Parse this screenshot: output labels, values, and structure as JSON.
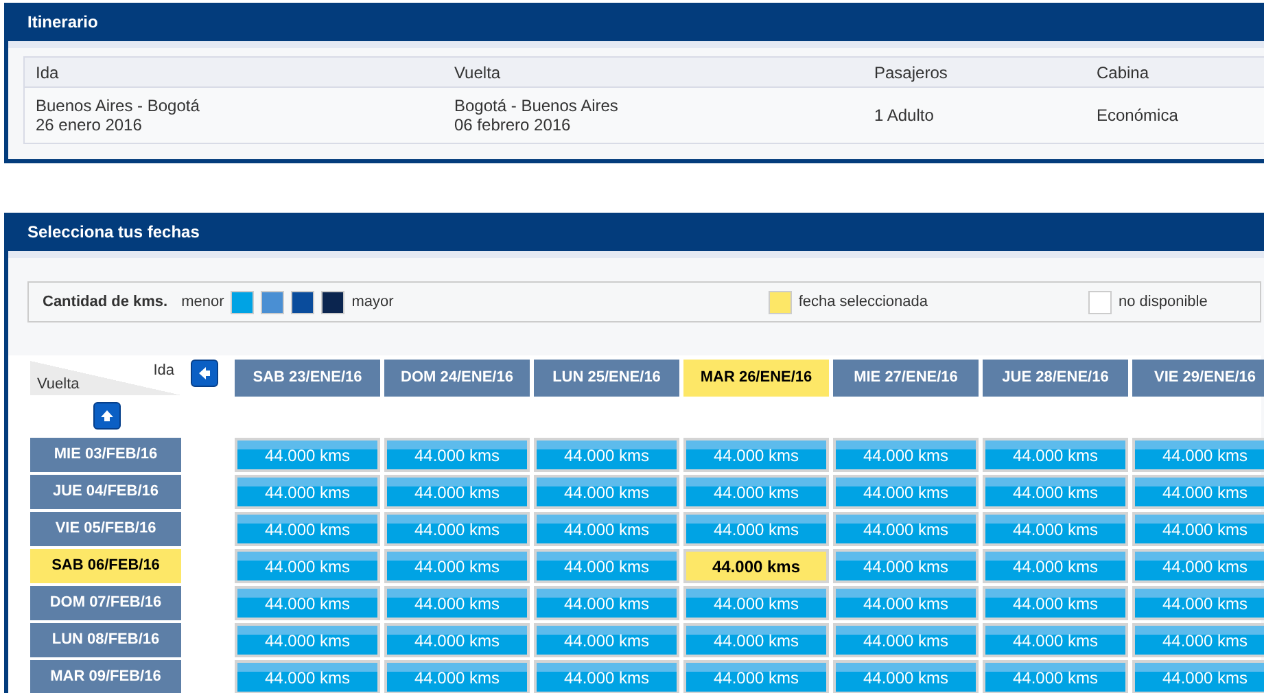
{
  "itinerary": {
    "title": "Itinerario",
    "columns": [
      "Ida",
      "Vuelta",
      "Pasajeros",
      "Cabina"
    ],
    "row": [
      {
        "lines": [
          "Buenos Aires - Bogotá",
          "26 enero 2016"
        ]
      },
      {
        "lines": [
          "Bogotá - Buenos Aires",
          "06 febrero 2016"
        ]
      },
      {
        "lines": [
          "1 Adulto"
        ]
      },
      {
        "lines": [
          "Económica"
        ]
      }
    ]
  },
  "dates": {
    "title": "Selecciona tus fechas",
    "legend": {
      "label": "Cantidad de kms.",
      "low": "menor",
      "high": "mayor",
      "swatches": [
        {
          "color": "#00a3e4"
        },
        {
          "color": "#4a8fd3"
        },
        {
          "color": "#0a4c9c"
        },
        {
          "color": "#0b254f"
        }
      ],
      "selected_label": "fecha seleccionada",
      "unavailable_label": "no disponible"
    },
    "corner": {
      "ida": "Ida",
      "vuelta": "Vuelta"
    },
    "columns": [
      {
        "label": "SAB 23/ENE/16",
        "selected": false
      },
      {
        "label": "DOM 24/ENE/16",
        "selected": false
      },
      {
        "label": "LUN 25/ENE/16",
        "selected": false
      },
      {
        "label": "MAR 26/ENE/16",
        "selected": true
      },
      {
        "label": "MIE 27/ENE/16",
        "selected": false
      },
      {
        "label": "JUE 28/ENE/16",
        "selected": false
      },
      {
        "label": "VIE 29/ENE/16",
        "selected": false
      }
    ],
    "rows": [
      {
        "label": "MIE 03/FEB/16",
        "selected": false,
        "cells": [
          {
            "text": "44.000 kms",
            "selected": false
          },
          {
            "text": "44.000 kms",
            "selected": false
          },
          {
            "text": "44.000 kms",
            "selected": false
          },
          {
            "text": "44.000 kms",
            "selected": false
          },
          {
            "text": "44.000 kms",
            "selected": false
          },
          {
            "text": "44.000 kms",
            "selected": false
          },
          {
            "text": "44.000 kms",
            "selected": false
          }
        ]
      },
      {
        "label": "JUE 04/FEB/16",
        "selected": false,
        "cells": [
          {
            "text": "44.000 kms",
            "selected": false
          },
          {
            "text": "44.000 kms",
            "selected": false
          },
          {
            "text": "44.000 kms",
            "selected": false
          },
          {
            "text": "44.000 kms",
            "selected": false
          },
          {
            "text": "44.000 kms",
            "selected": false
          },
          {
            "text": "44.000 kms",
            "selected": false
          },
          {
            "text": "44.000 kms",
            "selected": false
          }
        ]
      },
      {
        "label": "VIE 05/FEB/16",
        "selected": false,
        "cells": [
          {
            "text": "44.000 kms",
            "selected": false
          },
          {
            "text": "44.000 kms",
            "selected": false
          },
          {
            "text": "44.000 kms",
            "selected": false
          },
          {
            "text": "44.000 kms",
            "selected": false
          },
          {
            "text": "44.000 kms",
            "selected": false
          },
          {
            "text": "44.000 kms",
            "selected": false
          },
          {
            "text": "44.000 kms",
            "selected": false
          }
        ]
      },
      {
        "label": "SAB 06/FEB/16",
        "selected": true,
        "cells": [
          {
            "text": "44.000 kms",
            "selected": false
          },
          {
            "text": "44.000 kms",
            "selected": false
          },
          {
            "text": "44.000 kms",
            "selected": false
          },
          {
            "text": "44.000 kms",
            "selected": true
          },
          {
            "text": "44.000 kms",
            "selected": false
          },
          {
            "text": "44.000 kms",
            "selected": false
          },
          {
            "text": "44.000 kms",
            "selected": false
          }
        ]
      },
      {
        "label": "DOM 07/FEB/16",
        "selected": false,
        "cells": [
          {
            "text": "44.000 kms",
            "selected": false
          },
          {
            "text": "44.000 kms",
            "selected": false
          },
          {
            "text": "44.000 kms",
            "selected": false
          },
          {
            "text": "44.000 kms",
            "selected": false
          },
          {
            "text": "44.000 kms",
            "selected": false
          },
          {
            "text": "44.000 kms",
            "selected": false
          },
          {
            "text": "44.000 kms",
            "selected": false
          }
        ]
      },
      {
        "label": "LUN 08/FEB/16",
        "selected": false,
        "cells": [
          {
            "text": "44.000 kms",
            "selected": false
          },
          {
            "text": "44.000 kms",
            "selected": false
          },
          {
            "text": "44.000 kms",
            "selected": false
          },
          {
            "text": "44.000 kms",
            "selected": false
          },
          {
            "text": "44.000 kms",
            "selected": false
          },
          {
            "text": "44.000 kms",
            "selected": false
          },
          {
            "text": "44.000 kms",
            "selected": false
          }
        ]
      },
      {
        "label": "MAR 09/FEB/16",
        "selected": false,
        "cells": [
          {
            "text": "44.000 kms",
            "selected": false
          },
          {
            "text": "44.000 kms",
            "selected": false
          },
          {
            "text": "44.000 kms",
            "selected": false
          },
          {
            "text": "44.000 kms",
            "selected": false
          },
          {
            "text": "44.000 kms",
            "selected": false
          },
          {
            "text": "44.000 kms",
            "selected": false
          },
          {
            "text": "44.000 kms",
            "selected": false
          }
        ]
      }
    ]
  }
}
